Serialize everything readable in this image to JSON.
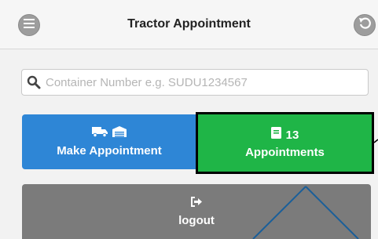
{
  "header": {
    "title": "Tractor Appointment",
    "menu_icon": "menu-icon",
    "back_icon": "back-icon"
  },
  "search": {
    "placeholder": "Container Number e.g. SUDU1234567",
    "value": "",
    "icon": "search-icon"
  },
  "tiles": {
    "make_appointment": {
      "label": "Make Appointment",
      "icons": [
        "truck-icon",
        "warehouse-icon"
      ],
      "color": "#2e86d6"
    },
    "appointments": {
      "label": "Appointments",
      "count": "13",
      "icon": "book-icon",
      "color": "#1fb547"
    },
    "logout": {
      "label": "logout",
      "icon": "sign-out-icon",
      "color": "#7b7b7b"
    }
  }
}
